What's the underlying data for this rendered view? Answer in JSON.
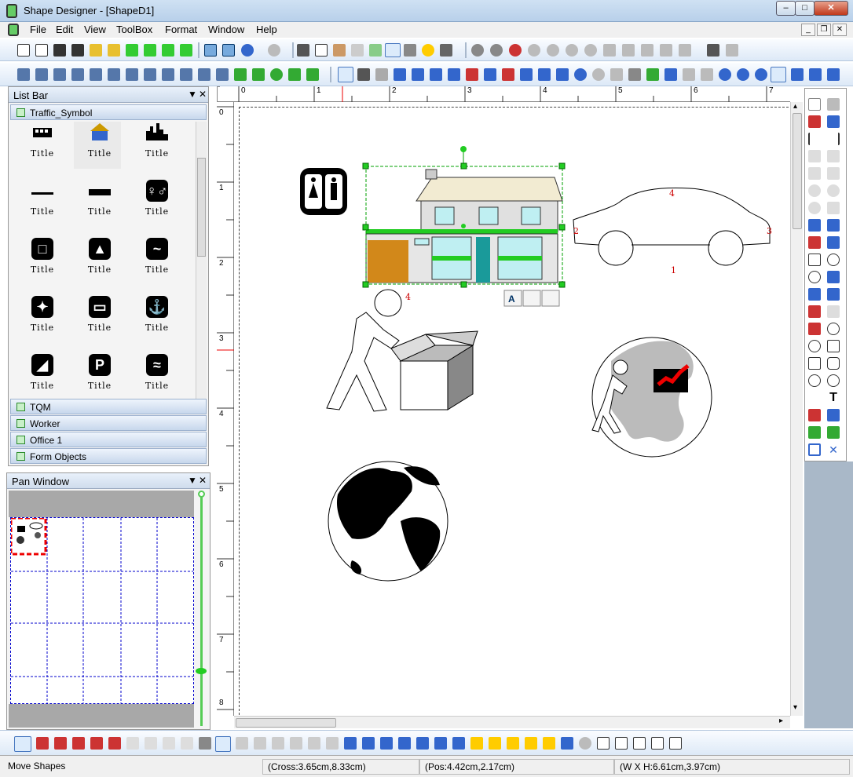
{
  "window": {
    "title": "Shape Designer - [ShapeD1]",
    "min": "–",
    "max": "□",
    "close": "✕"
  },
  "menu": [
    "File",
    "Edit",
    "View",
    "ToolBox",
    "Format",
    "Window",
    "Help"
  ],
  "listbar": {
    "title": "List Bar",
    "active_group": "Traffic_Symbol",
    "item_label": "Title",
    "item_glyphs": [
      "",
      "",
      "",
      "",
      "",
      "",
      "",
      "",
      "",
      "",
      "",
      "",
      "",
      "",
      "",
      "P",
      ""
    ],
    "groups": [
      "TQM",
      "Worker",
      "Office 1",
      "Form Objects"
    ]
  },
  "panwindow": {
    "title": "Pan Window"
  },
  "rulers": {
    "top": [
      "0",
      "1",
      "2",
      "3",
      "4",
      "5",
      "6",
      "7"
    ],
    "left": [
      "0",
      "1",
      "2",
      "3",
      "4",
      "5",
      "6",
      "7",
      "8"
    ]
  },
  "shapes": {
    "car_numbers": [
      "1",
      "2",
      "3",
      "4"
    ],
    "house_num": "4"
  },
  "status": {
    "mode": "Move Shapes",
    "cross": "(Cross:3.65cm,8.33cm)",
    "pos": "(Pos:4.42cm,2.17cm)",
    "size": "(W X H:6.61cm,3.97cm)"
  },
  "colors": {
    "accent": "#316ac5",
    "selection": "#00a000",
    "handles": "#00c000"
  }
}
